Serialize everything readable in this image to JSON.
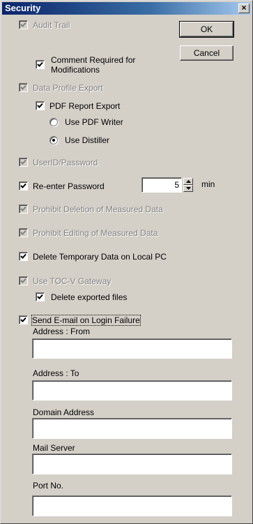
{
  "dialog": {
    "title": "Security",
    "close_glyph": "×"
  },
  "buttons": {
    "ok": "OK",
    "cancel": "Cancel"
  },
  "options": {
    "audit_trail": "Audit Trail",
    "comment_required": "Comment Required for Modifications",
    "comment_required_line1": "Comment Required for",
    "comment_required_line2": "Modifications",
    "data_profile_export": "Data Profile Export",
    "pdf_report_export": "PDF Report Export",
    "use_pdf_writer": "Use PDF Writer",
    "use_distiller": "Use Distiller",
    "userid_password": "UserID/Password",
    "reenter_password": "Re-enter Password",
    "reenter_value": "5",
    "reenter_unit": "min",
    "prohibit_deletion": "Prohibit Deletion of Measured Data",
    "prohibit_editing": "Prohibit Editing of Measured Data",
    "delete_temp": "Delete Temporary Data on Local PC",
    "use_toc_gateway": "Use TOC-V Gateway",
    "delete_exported": "Delete exported files",
    "send_email": "Send E-mail on Login Failure"
  },
  "fields": {
    "address_from": {
      "label": "Address : From",
      "value": ""
    },
    "address_to": {
      "label": "Address : To",
      "value": ""
    },
    "domain_address": {
      "label": "Domain Address",
      "value": ""
    },
    "mail_server": {
      "label": "Mail Server",
      "value": ""
    },
    "port_no": {
      "label": "Port No.",
      "value": ""
    }
  },
  "colors": {
    "face": "#d4d0c8",
    "title_start": "#0a246a",
    "disabled_text": "#808080"
  }
}
